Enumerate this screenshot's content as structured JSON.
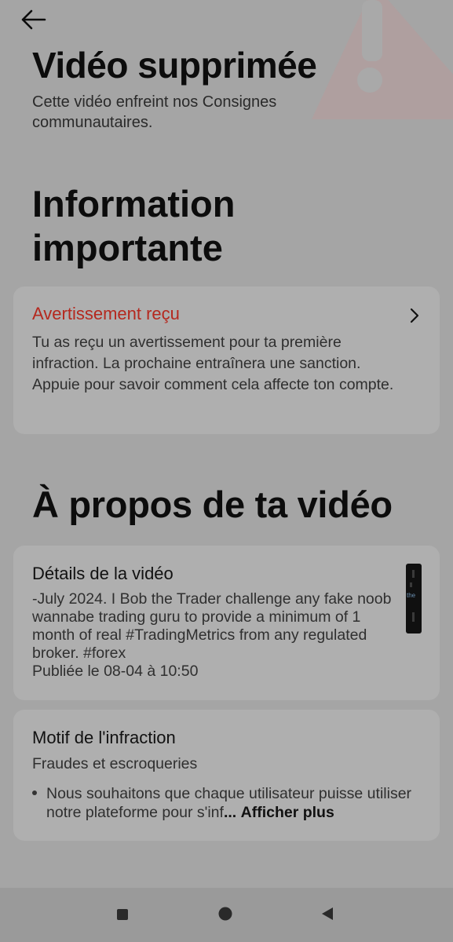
{
  "header": {
    "title": "Vidéo supprimée",
    "subtitle": "Cette vidéo enfreint nos Consignes communautaires."
  },
  "important": {
    "heading": "Information importante",
    "card": {
      "title": "Avertissement reçu",
      "body": "Tu as reçu un avertissement pour ta première infraction. La prochaine entraînera une sanction. Appuie pour savoir comment cela affecte ton compte."
    }
  },
  "about": {
    "heading": "À propos de ta vidéo",
    "details": {
      "title": "Détails de la vidéo",
      "description": "-July 2024. I Bob the Trader challenge any fake noob wannabe trading guru to provide a minimum of 1 month of real #TradingMetrics from any regulated broker. #forex",
      "published": "Publiée le 08-04 à 10:50",
      "thumb_text": "the"
    },
    "violation": {
      "title": "Motif de l'infraction",
      "category": "Fraudes et escroqueries",
      "text": "Nous souhaitons que chaque utilisateur puisse utiliser notre plateforme pour s'inf",
      "ellipsis": "...",
      "more_label": "Afficher plus"
    }
  },
  "colors": {
    "warning_red": "#b5281e",
    "background": "#a5a5a5",
    "card": "#afafaf"
  },
  "icons": {
    "back": "arrow-left-icon",
    "chevron": "chevron-right-icon",
    "warning": "warning-triangle-icon",
    "nav": [
      "square-icon",
      "circle-icon",
      "triangle-back-icon"
    ]
  }
}
